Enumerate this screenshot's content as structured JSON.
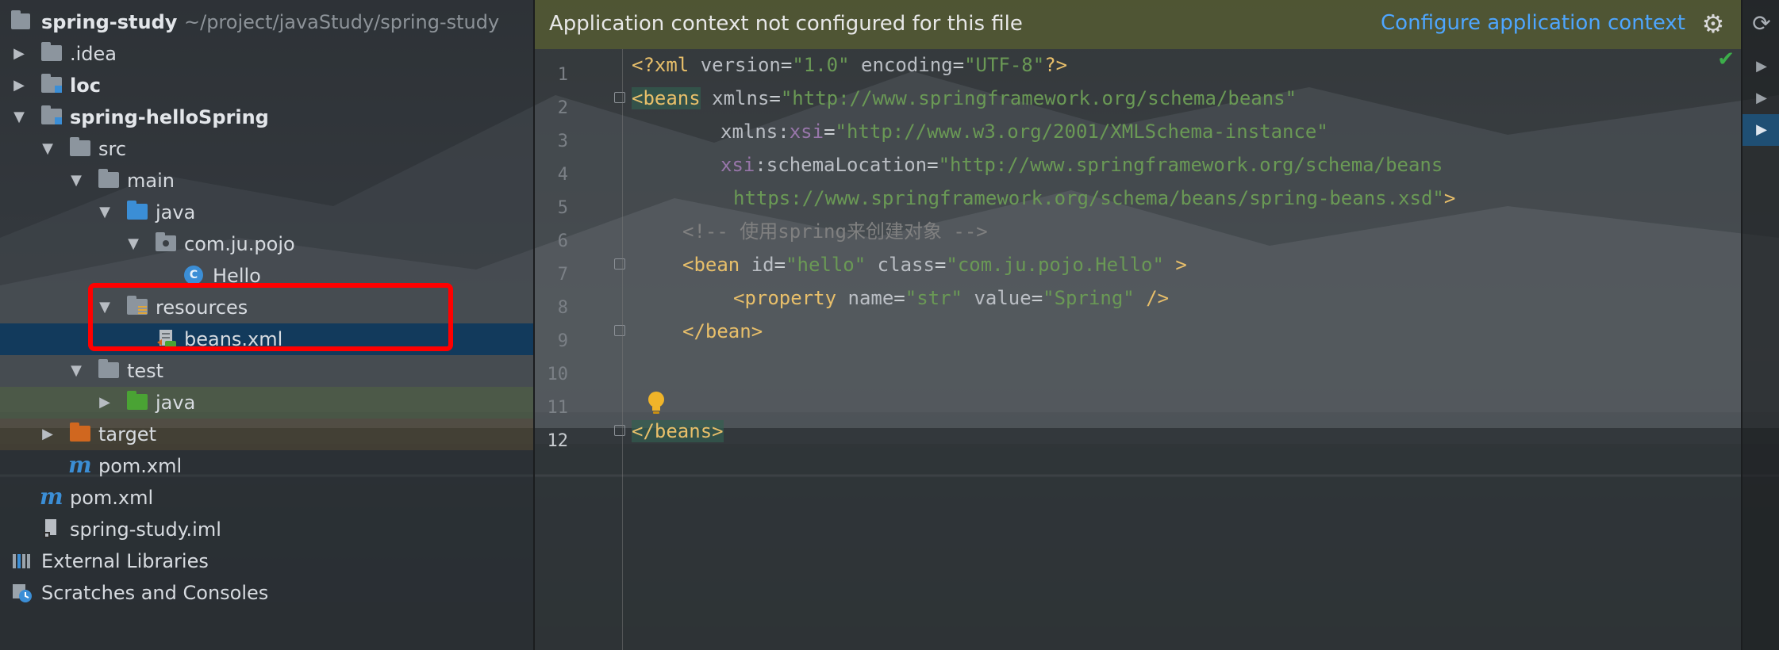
{
  "project_tree": {
    "root": {
      "name": "spring-study",
      "path": "~/project/javaStudy/spring-study"
    },
    "items": [
      {
        "label": ".idea",
        "icon": "folder-icon"
      },
      {
        "label": "loc",
        "icon": "module-folder-icon"
      },
      {
        "label": "spring-helloSpring",
        "icon": "module-folder-icon"
      },
      {
        "label": "src",
        "icon": "folder-icon"
      },
      {
        "label": "main",
        "icon": "folder-icon"
      },
      {
        "label": "java",
        "icon": "source-folder-icon"
      },
      {
        "label": "com.ju.pojo",
        "icon": "package-icon"
      },
      {
        "label": "Hello",
        "icon": "class-icon",
        "badge": "C"
      },
      {
        "label": "resources",
        "icon": "resources-folder-icon"
      },
      {
        "label": "beans.xml",
        "icon": "spring-xml-icon"
      },
      {
        "label": "test",
        "icon": "folder-icon"
      },
      {
        "label": "java",
        "icon": "test-source-folder-icon"
      },
      {
        "label": "target",
        "icon": "excluded-folder-icon"
      },
      {
        "label": "pom.xml",
        "icon": "maven-icon",
        "badge": "m"
      },
      {
        "label": "pom.xml",
        "icon": "maven-icon",
        "badge": "m"
      },
      {
        "label": "spring-study.iml",
        "icon": "iml-file-icon"
      },
      {
        "label": "External Libraries",
        "icon": "libraries-icon"
      },
      {
        "label": "Scratches and Consoles",
        "icon": "scratches-icon"
      }
    ]
  },
  "editor": {
    "banner": {
      "message": "Application context not configured for this file",
      "action": "Configure application context"
    },
    "line_numbers": [
      "1",
      "2",
      "3",
      "4",
      "5",
      "6",
      "7",
      "8",
      "9",
      "10",
      "11",
      "12"
    ],
    "code": {
      "l1": {
        "a": "<?xml ",
        "b": "version",
        "c": "=",
        "d": "\"1.0\"",
        "e": " encoding",
        "f": "=",
        "g": "\"UTF-8\"",
        "h": "?>"
      },
      "l2": {
        "a": "<beans",
        "b": " xmlns",
        "c": "=",
        "d": "\"http://www.springframework.org/schema/beans\""
      },
      "l3": {
        "a": "xmlns:",
        "b": "xsi",
        "c": "=",
        "d": "\"http://www.w3.org/2001/XMLSchema-instance\""
      },
      "l4": {
        "a": "xsi",
        "b": ":schemaLocation",
        "c": "=",
        "d": "\"http://www.springframework.org/schema/beans"
      },
      "l5": {
        "a": "https://www.springframework.org/schema/beans/spring-beans.xsd\"",
        "b": ">"
      },
      "l6": {
        "a": "<!-- 使用spring来创建对象 -->"
      },
      "l7": {
        "a": "<bean",
        "b": " id",
        "c": "=",
        "d": "\"hello\"",
        "e": " class",
        "f": "=",
        "g": "\"com.ju.pojo.Hello\"",
        "h": " >"
      },
      "l8": {
        "a": "<property",
        "b": " name",
        "c": "=",
        "d": "\"str\"",
        "e": " value",
        "f": "=",
        "g": "\"Spring\"",
        "h": " />"
      },
      "l9": {
        "a": "</bean>"
      },
      "l12": {
        "a": "</beans>"
      }
    }
  },
  "colors": {
    "xml_tag": "#e8bf6a",
    "xml_value": "#6a9955",
    "xml_namespace": "#9876aa",
    "comment": "#808080",
    "link": "#4ea6ff",
    "highlight_box": "#ff0000",
    "selection": "#123a5c"
  }
}
